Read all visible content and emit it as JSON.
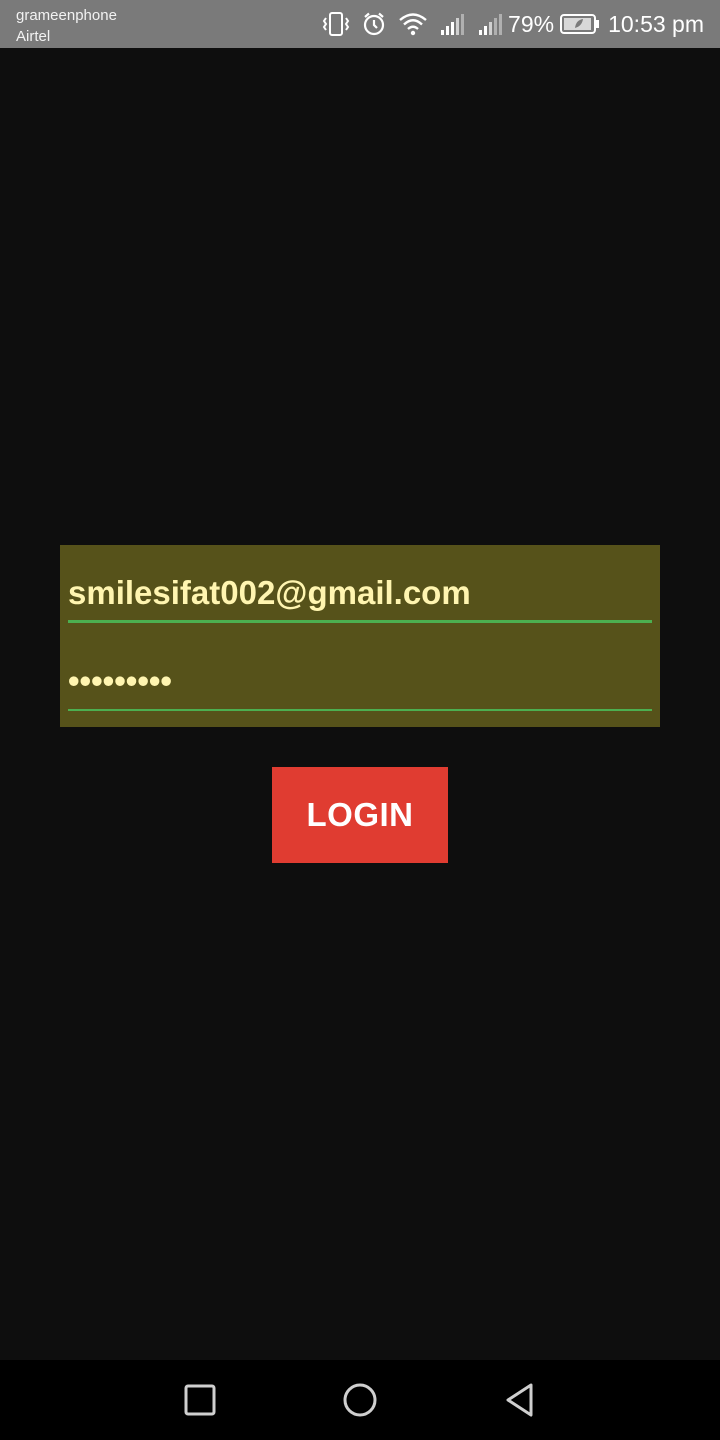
{
  "status_bar": {
    "carrier_primary": "grameenphone",
    "carrier_secondary": "Airtel",
    "battery_percent": "79%",
    "time": "10:53 pm",
    "icons": [
      "vibrate-icon",
      "alarm-icon",
      "wifi-icon",
      "signal-icon",
      "signal-icon",
      "battery-icon"
    ]
  },
  "login_form": {
    "email_value": "smilesifat002@gmail.com",
    "password_value": "•••••••••",
    "login_label": "LOGIN"
  },
  "colors": {
    "background": "#0e0e0e",
    "panel": "#56521a",
    "input_text": "#fff5b0",
    "underline": "#4caf50",
    "button": "#e03c31",
    "status_bar": "#7a7a7a"
  },
  "nav_bar": {
    "icons": [
      "recents-icon",
      "home-icon",
      "back-icon"
    ]
  }
}
